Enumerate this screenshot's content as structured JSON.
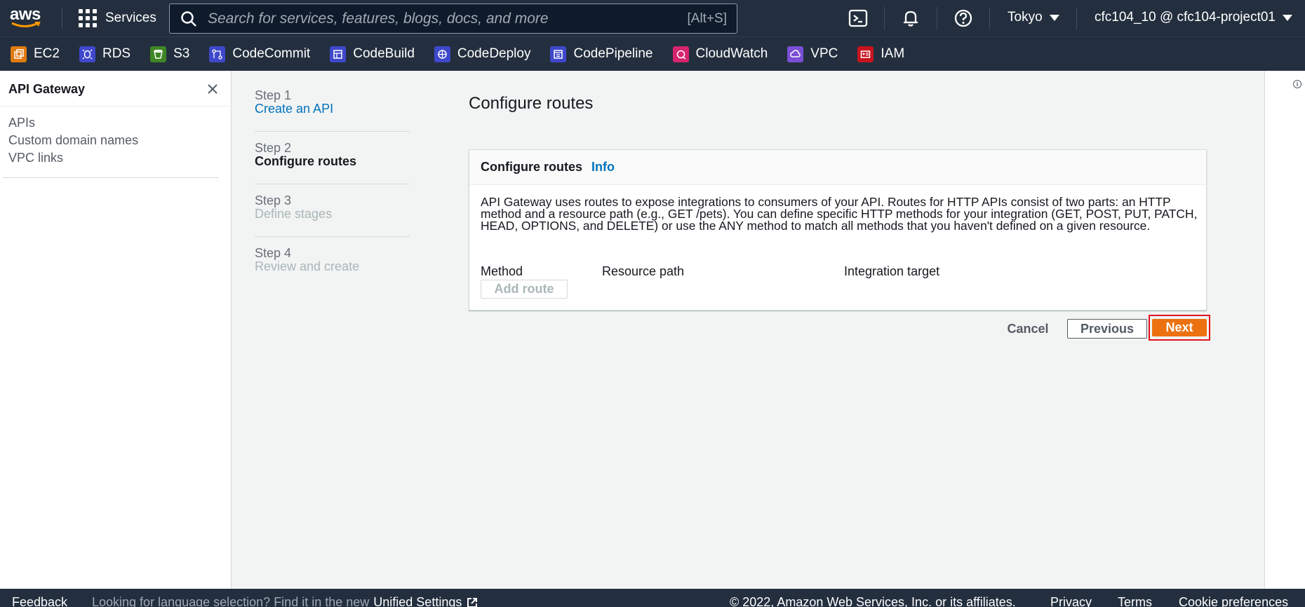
{
  "topnav": {
    "logo_text": "aws",
    "services_label": "Services",
    "search_placeholder": "Search for services, features, blogs, docs, and more",
    "search_shortcut": "[Alt+S]",
    "region": "Tokyo",
    "account": "cfc104_10 @ cfc104-project01",
    "icons": [
      "cloudshell-icon",
      "bell-icon",
      "help-icon"
    ]
  },
  "favorites": [
    {
      "label": "EC2",
      "color": "#e07b12",
      "icon": "ec2-icon"
    },
    {
      "label": "RDS",
      "color": "#3f48cc",
      "icon": "rds-icon"
    },
    {
      "label": "S3",
      "color": "#3f8624",
      "icon": "s3-icon"
    },
    {
      "label": "CodeCommit",
      "color": "#3f48cc",
      "icon": "codecommit-icon"
    },
    {
      "label": "CodeBuild",
      "color": "#3f48cc",
      "icon": "codebuild-icon"
    },
    {
      "label": "CodeDeploy",
      "color": "#3f48cc",
      "icon": "codedeploy-icon"
    },
    {
      "label": "CodePipeline",
      "color": "#3f48cc",
      "icon": "codepipeline-icon"
    },
    {
      "label": "CloudWatch",
      "color": "#d6246e",
      "icon": "cloudwatch-icon"
    },
    {
      "label": "VPC",
      "color": "#7a4fd6",
      "icon": "vpc-icon"
    },
    {
      "label": "IAM",
      "color": "#c7131f",
      "icon": "iam-icon"
    }
  ],
  "sidenav": {
    "title": "API Gateway",
    "links": [
      "APIs",
      "Custom domain names",
      "VPC links"
    ]
  },
  "steps": [
    {
      "num": "Step 1",
      "label": "Create an API",
      "state": "link"
    },
    {
      "num": "Step 2",
      "label": "Configure routes",
      "state": "active"
    },
    {
      "num": "Step 3",
      "label": "Define stages",
      "state": "disabled"
    },
    {
      "num": "Step 4",
      "label": "Review and create",
      "state": "disabled"
    }
  ],
  "main": {
    "page_title": "Configure routes",
    "panel_title": "Configure routes",
    "panel_info": "Info",
    "description": "API Gateway uses routes to expose integrations to consumers of your API. Routes for HTTP APIs consist of two parts: an HTTP method and a resource path (e.g., GET /pets). You can define specific HTTP methods for your integration (GET, POST, PUT, PATCH, HEAD, OPTIONS, and DELETE) or use the ANY method to match all methods that you haven't defined on a given resource.",
    "columns": [
      "Method",
      "Resource path",
      "Integration target"
    ],
    "add_route": "Add route",
    "cancel": "Cancel",
    "previous": "Previous",
    "next": "Next"
  },
  "footer": {
    "feedback": "Feedback",
    "language_prompt": "Looking for language selection? Find it in the new",
    "unified_settings": "Unified Settings",
    "copyright": "© 2022, Amazon Web Services, Inc. or its affiliates.",
    "privacy": "Privacy",
    "terms": "Terms",
    "cookie": "Cookie preferences"
  }
}
